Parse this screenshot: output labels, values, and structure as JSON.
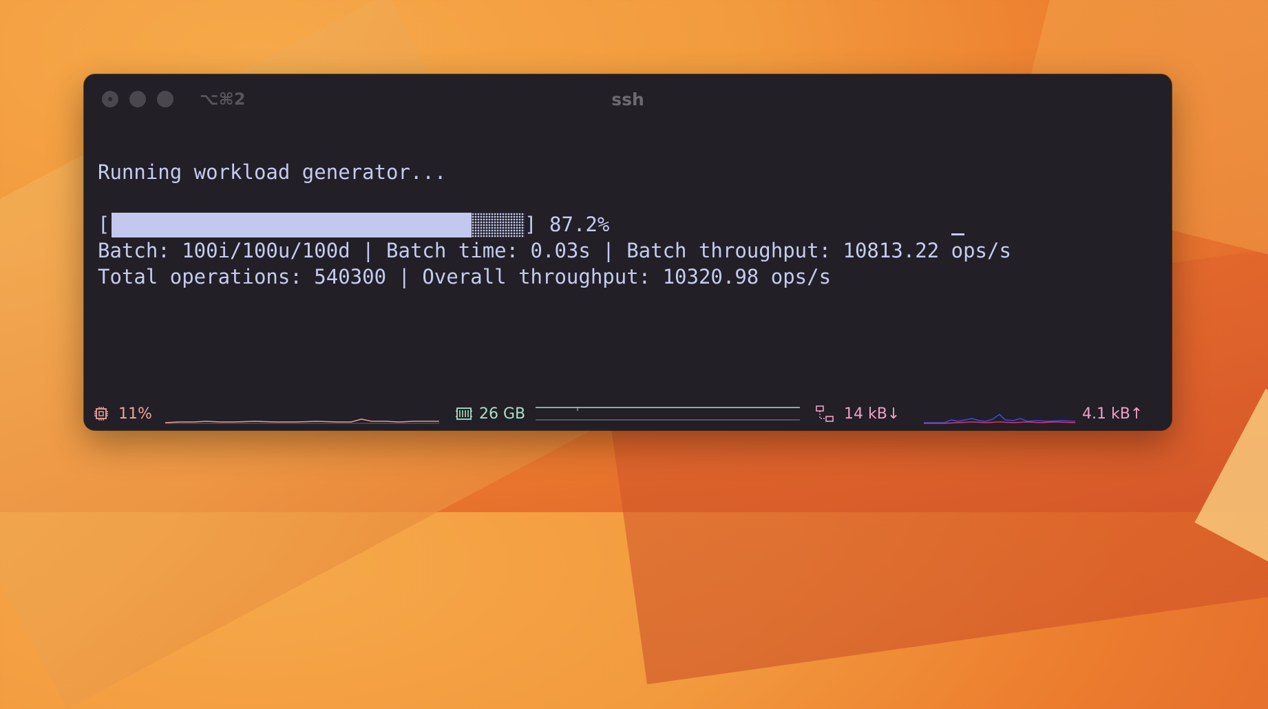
{
  "window": {
    "shortcut": "⌥⌘2",
    "title": "ssh"
  },
  "terminal": {
    "line1": "Running workload generator...",
    "bracket_open": "[",
    "bracket_close": "]",
    "progress_fraction": 0.872,
    "progress_text": "87.2%",
    "line4": "Batch: 100i/100u/100d | Batch time: 0.03s | Batch throughput: 10813.22 ops/s",
    "line5": "Total operations: 540300 | Overall throughput: 10320.98 ops/s"
  },
  "statusbar": {
    "cpu": {
      "icon": "cpu-icon",
      "value": "11%",
      "color": "#f1a39b"
    },
    "memory": {
      "icon": "memory-icon",
      "value": "26 GB",
      "color": "#a7e0c9"
    },
    "network": {
      "icon": "network-icon",
      "download": "14 kB↓",
      "upload": "4.1 kB↑",
      "color": "#f0a0c7"
    }
  },
  "colors": {
    "terminal_bg": "#221f26",
    "terminal_fg": "#c6cbf1"
  }
}
